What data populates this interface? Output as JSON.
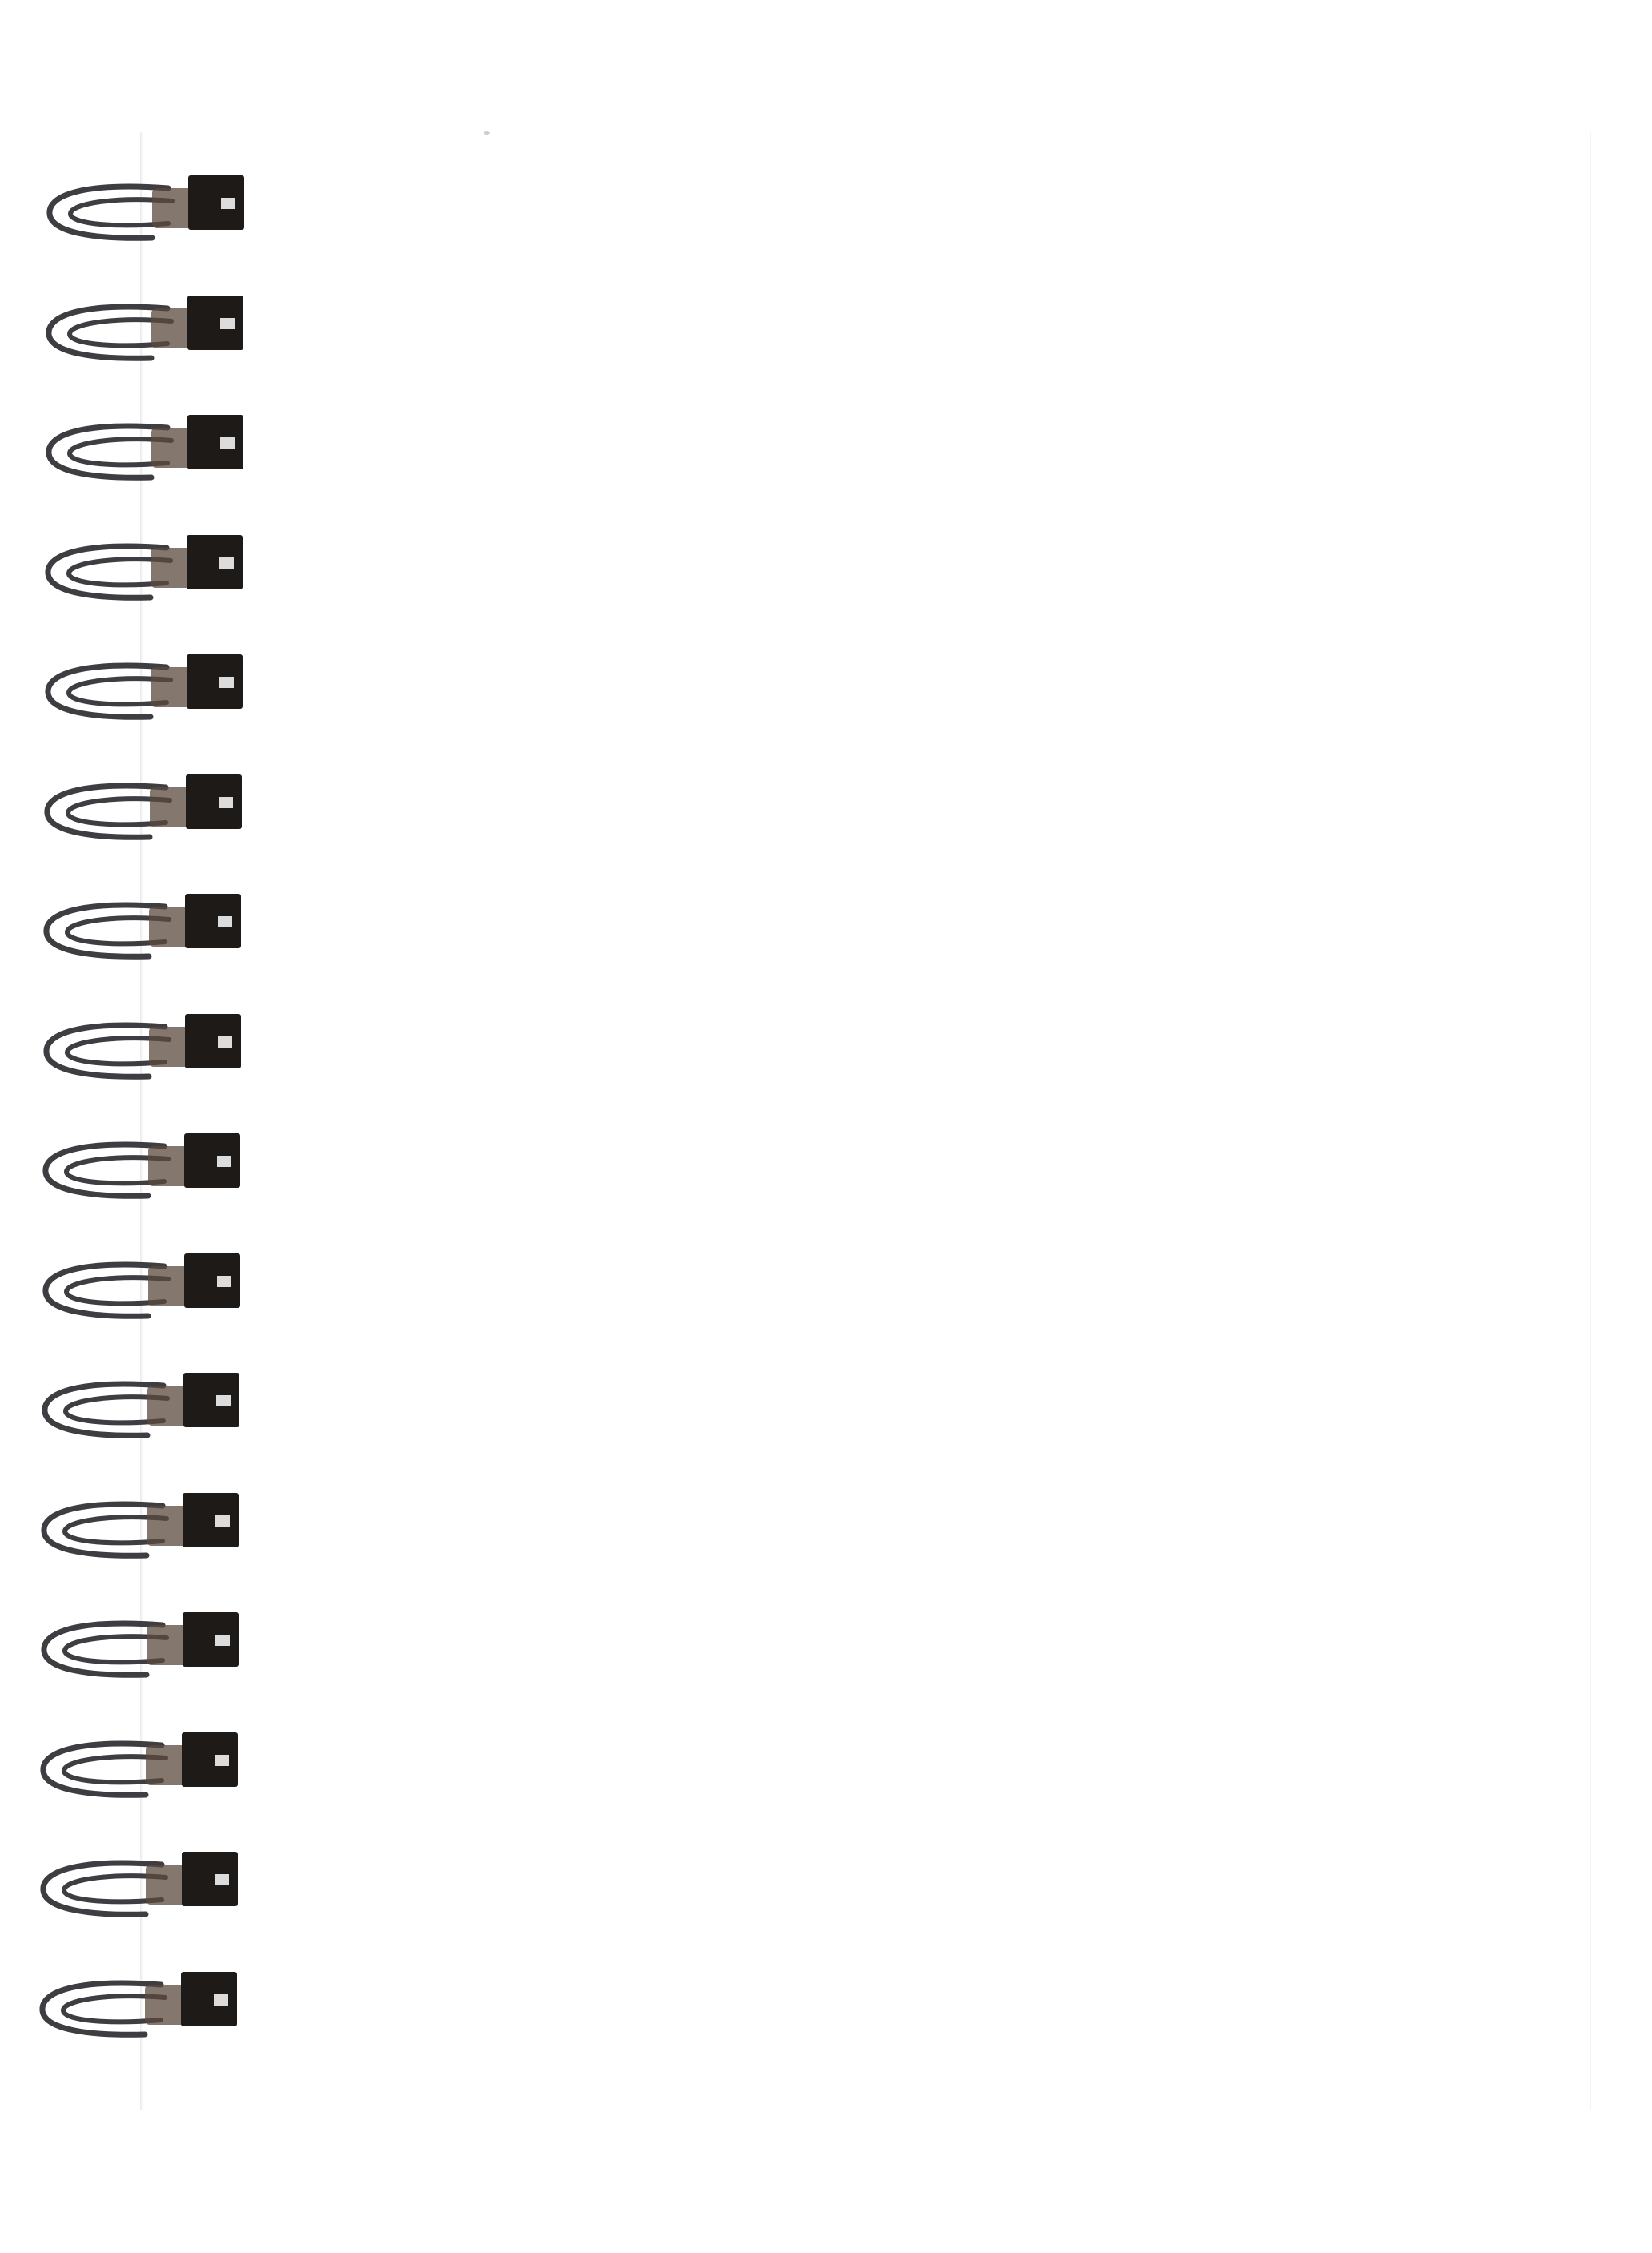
{
  "image": {
    "subject": "spiral-bound-notebook-page",
    "background_color": "#ffffff",
    "page_color": "#ffffff",
    "binding": {
      "ring_count": 16,
      "wire_color": "#3d3d42",
      "clip_color": "#1e1a18",
      "clip_shadow_color": "#5a4a3e"
    }
  }
}
